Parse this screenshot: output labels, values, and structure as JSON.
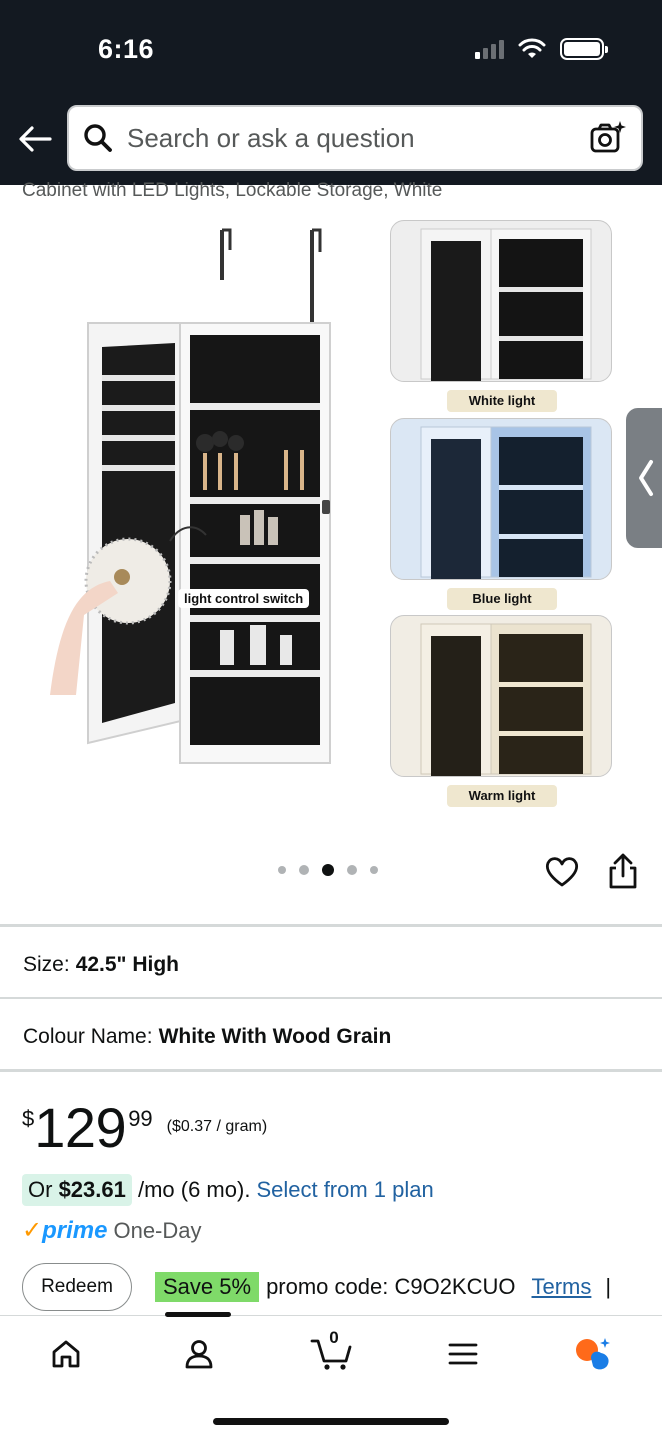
{
  "status_bar": {
    "time": "6:16"
  },
  "header": {
    "search_placeholder": "Search or ask a question"
  },
  "product": {
    "title_fragment": "Cabinet with LED Lights, Lockable Storage, White",
    "image_labels": {
      "callout": "light control switch",
      "thumbnails": [
        "White light",
        "Blue light",
        "Warm light"
      ]
    },
    "gallery": {
      "total_images": 5,
      "active_index": 3
    }
  },
  "variations": {
    "size_label": "Size:",
    "size_value": "42.5\" High",
    "colour_label": "Colour Name:",
    "colour_value": "White With Wood Grain"
  },
  "price": {
    "symbol": "$",
    "whole": "129",
    "fraction": "99",
    "unit_price": "($0.37 / gram)"
  },
  "installments": {
    "prefix": "Or ",
    "amount": "$23.61",
    "suffix": " /mo (6 mo).",
    "link": "Select from 1 plan"
  },
  "delivery": {
    "check": "✓",
    "prime": "prime",
    "speed": "One-Day"
  },
  "promo": {
    "redeem_label": "Redeem",
    "save_badge": "Save 5%",
    "code_text": "promo code: C9O2KCUO",
    "terms_link": "Terms",
    "separator": "|"
  },
  "bottom_nav": {
    "cart_count": "0",
    "items": [
      "home-icon",
      "account-icon",
      "cart-icon",
      "menu-icon",
      "rufus-icon"
    ]
  },
  "colors": {
    "header_bg": "#131921",
    "link": "#2162a1",
    "prime_blue": "#1a98ff",
    "save_green": "#7fda69",
    "installment_bg": "#d9f3e8"
  }
}
